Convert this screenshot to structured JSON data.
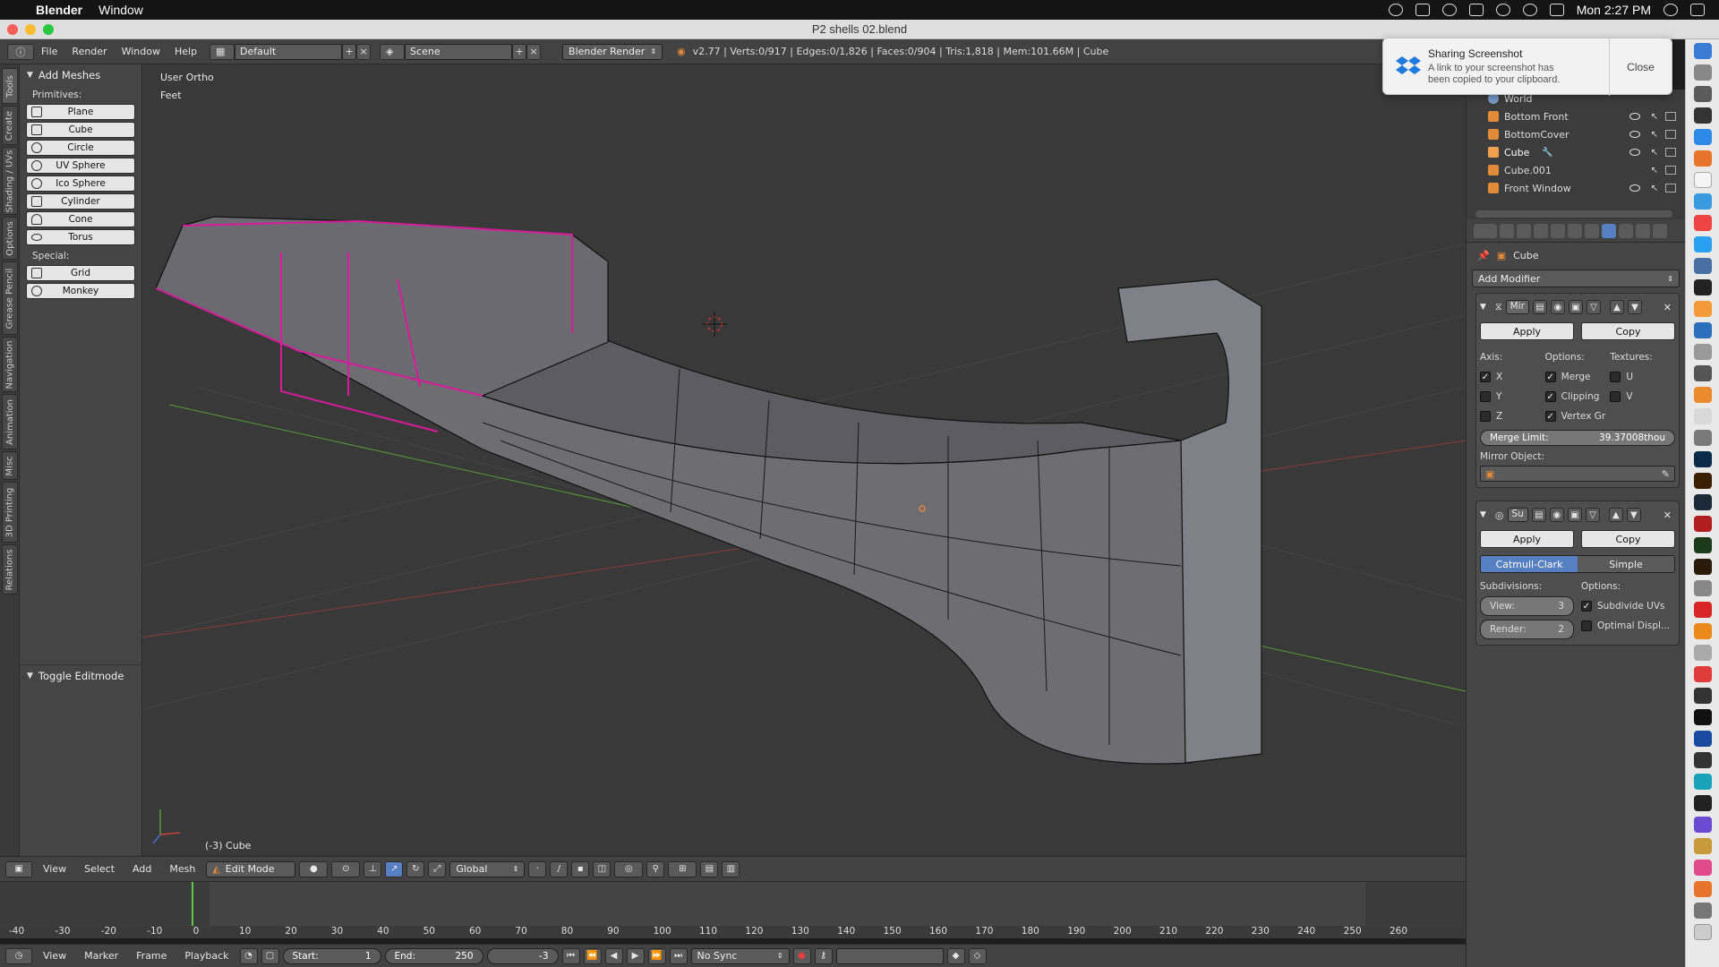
{
  "os_menubar": {
    "app_name": "Blender",
    "menu_window": "Window",
    "clock": "Mon 2:27 PM"
  },
  "window": {
    "title": "P2 shells 02.blend"
  },
  "info_header": {
    "menus": [
      "File",
      "Render",
      "Window",
      "Help"
    ],
    "layout": "Default",
    "scene": "Scene",
    "render_engine": "Blender Render",
    "stats": "v2.77 | Verts:0/917 | Edges:0/1,826 | Faces:0/904 | Tris:1,818 | Mem:101.66M | Cube"
  },
  "left_tabs": [
    "Tools",
    "Create",
    "Shading / UVs",
    "Options",
    "Grease Pencil",
    "Navigation",
    "Animation",
    "Misc",
    "3D Printing",
    "Relations"
  ],
  "tool_shelf": {
    "panel_title": "Add Meshes",
    "primitives_label": "Primitives:",
    "primitives": [
      "Plane",
      "Cube",
      "Circle",
      "UV Sphere",
      "Ico Sphere",
      "Cylinder",
      "Cone",
      "Torus"
    ],
    "special_label": "Special:",
    "special": [
      "Grid",
      "Monkey"
    ],
    "operator_panel": "Toggle Editmode"
  },
  "viewport": {
    "view_name": "User Ortho",
    "units": "Feet",
    "object_label": "(-3) Cube"
  },
  "viewport_header": {
    "menus": [
      "View",
      "Select",
      "Add",
      "Mesh"
    ],
    "mode": "Edit Mode",
    "orientation": "Global"
  },
  "timeline": {
    "ticks": [
      "-40",
      "-30",
      "-20",
      "-10",
      "0",
      "10",
      "20",
      "30",
      "40",
      "50",
      "60",
      "70",
      "80",
      "90",
      "100",
      "110",
      "120",
      "130",
      "140",
      "150",
      "160",
      "170",
      "180",
      "190",
      "200",
      "210",
      "220",
      "230",
      "240",
      "250",
      "260"
    ],
    "menus": [
      "View",
      "Marker",
      "Frame",
      "Playback"
    ],
    "start_label": "Start:",
    "start": "1",
    "end_label": "End:",
    "end": "250",
    "current": "-3",
    "sync": "No Sync"
  },
  "outliner": {
    "items": [
      "World",
      "Bottom Front",
      "BottomCover",
      "Cube",
      "Cube.001",
      "Front Window"
    ]
  },
  "properties": {
    "object": "Cube",
    "add_modifier": "Add Modifier",
    "mirror": {
      "name": "Mir",
      "apply": "Apply",
      "copy": "Copy",
      "axis_label": "Axis:",
      "options_label": "Options:",
      "textures_label": "Textures:",
      "axes": [
        "X",
        "Y",
        "Z"
      ],
      "options": [
        "Merge",
        "Clipping",
        "Vertex Gr"
      ],
      "textures": [
        "U",
        "V"
      ],
      "merge_limit_label": "Merge Limit:",
      "merge_limit": "39.37008thou",
      "mirror_object_label": "Mirror Object:"
    },
    "subsurf": {
      "name": "Su",
      "apply": "Apply",
      "copy": "Copy",
      "mode_a": "Catmull-Clark",
      "mode_b": "Simple",
      "subdivisions_label": "Subdivisions:",
      "options_label": "Options:",
      "view_label": "View:",
      "view": "3",
      "render_label": "Render:",
      "render": "2",
      "subdivide_uvs": "Subdivide UVs",
      "optimal_display": "Optimal Displ..."
    }
  },
  "notification": {
    "title": "Sharing Screenshot",
    "message": "A link to your screenshot has been copied to your clipboard.",
    "close": "Close"
  },
  "colors": {
    "accent_blue": "#5680c2",
    "edge_pink": "#d81b9c",
    "timeline_green": "#5ec74c"
  }
}
